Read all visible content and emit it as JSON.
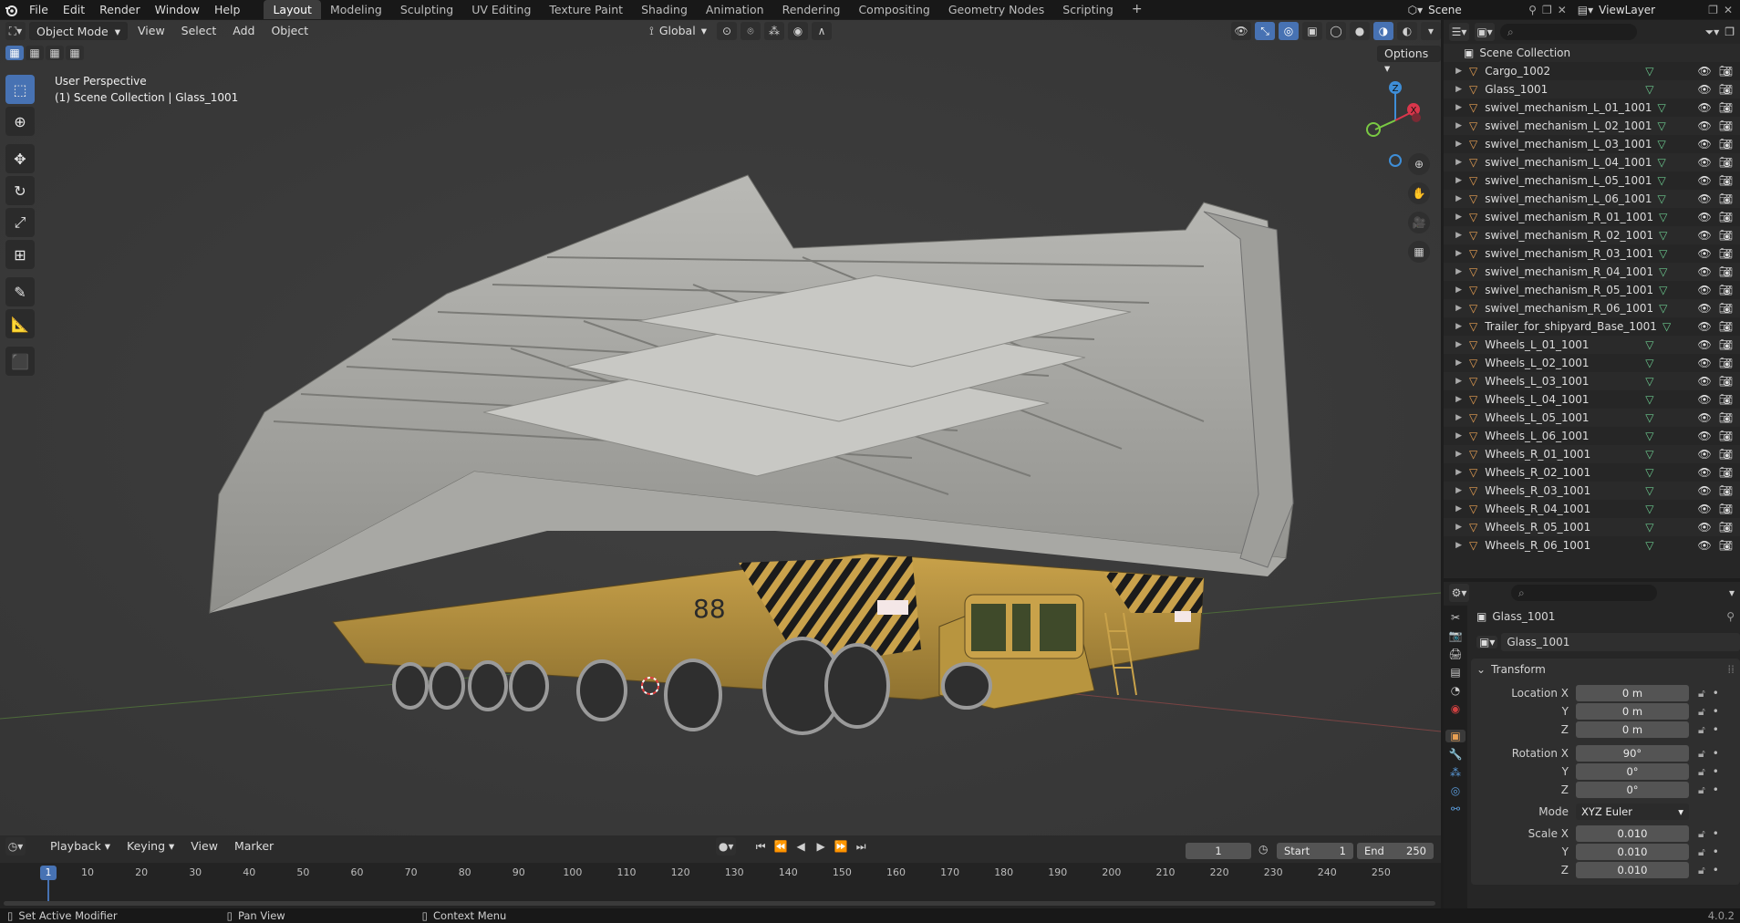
{
  "topbar": {
    "menus": [
      "File",
      "Edit",
      "Render",
      "Window",
      "Help"
    ],
    "workspaces": [
      "Layout",
      "Modeling",
      "Sculpting",
      "UV Editing",
      "Texture Paint",
      "Shading",
      "Animation",
      "Rendering",
      "Compositing",
      "Geometry Nodes",
      "Scripting"
    ],
    "active_workspace": "Layout",
    "scene_label": "Scene",
    "viewlayer_label": "ViewLayer"
  },
  "viewport": {
    "mode": "Object Mode",
    "menus": [
      "View",
      "Select",
      "Add",
      "Object"
    ],
    "orientation": "Global",
    "options_label": "Options",
    "overlay_title": "User Perspective",
    "overlay_subtitle": "(1) Scene Collection | Glass_1001",
    "gizmo": {
      "x": "X",
      "y": "Y",
      "z": "Z"
    },
    "model_marking": "88"
  },
  "timeline": {
    "menus": [
      "Playback",
      "Keying",
      "View",
      "Marker"
    ],
    "current_frame": "1",
    "start_label": "Start",
    "start_value": "1",
    "end_label": "End",
    "end_value": "250",
    "ruler": [
      "10",
      "20",
      "30",
      "40",
      "50",
      "60",
      "70",
      "80",
      "90",
      "100",
      "110",
      "120",
      "130",
      "140",
      "150",
      "160",
      "170",
      "180",
      "190",
      "200",
      "210",
      "220",
      "230",
      "240",
      "250"
    ],
    "ruler_current": "1"
  },
  "statusbar": {
    "left": "Set Active Modifier",
    "middle": "Pan View",
    "right": "Context Menu",
    "version": "4.0.2"
  },
  "outliner": {
    "root": "Scene Collection",
    "items": [
      {
        "name": "Cargo_1002",
        "icon": "mesh-object-icon"
      },
      {
        "name": "Glass_1001",
        "icon": "mesh-object-icon"
      },
      {
        "name": "swivel_mechanism_L_01_1001",
        "icon": "mesh-object-icon"
      },
      {
        "name": "swivel_mechanism_L_02_1001",
        "icon": "mesh-object-icon"
      },
      {
        "name": "swivel_mechanism_L_03_1001",
        "icon": "mesh-object-icon"
      },
      {
        "name": "swivel_mechanism_L_04_1001",
        "icon": "mesh-object-icon"
      },
      {
        "name": "swivel_mechanism_L_05_1001",
        "icon": "mesh-object-icon"
      },
      {
        "name": "swivel_mechanism_L_06_1001",
        "icon": "mesh-object-icon"
      },
      {
        "name": "swivel_mechanism_R_01_1001",
        "icon": "mesh-object-icon"
      },
      {
        "name": "swivel_mechanism_R_02_1001",
        "icon": "mesh-object-icon"
      },
      {
        "name": "swivel_mechanism_R_03_1001",
        "icon": "mesh-object-icon"
      },
      {
        "name": "swivel_mechanism_R_04_1001",
        "icon": "mesh-object-icon"
      },
      {
        "name": "swivel_mechanism_R_05_1001",
        "icon": "mesh-object-icon"
      },
      {
        "name": "swivel_mechanism_R_06_1001",
        "icon": "mesh-object-icon"
      },
      {
        "name": "Trailer_for_shipyard_Base_1001",
        "icon": "mesh-object-icon"
      },
      {
        "name": "Wheels_L_01_1001",
        "icon": "mesh-object-icon"
      },
      {
        "name": "Wheels_L_02_1001",
        "icon": "mesh-object-icon"
      },
      {
        "name": "Wheels_L_03_1001",
        "icon": "mesh-object-icon"
      },
      {
        "name": "Wheels_L_04_1001",
        "icon": "mesh-object-icon"
      },
      {
        "name": "Wheels_L_05_1001",
        "icon": "mesh-object-icon"
      },
      {
        "name": "Wheels_L_06_1001",
        "icon": "mesh-object-icon"
      },
      {
        "name": "Wheels_R_01_1001",
        "icon": "mesh-object-icon"
      },
      {
        "name": "Wheels_R_02_1001",
        "icon": "mesh-object-icon"
      },
      {
        "name": "Wheels_R_03_1001",
        "icon": "mesh-object-icon"
      },
      {
        "name": "Wheels_R_04_1001",
        "icon": "mesh-object-icon"
      },
      {
        "name": "Wheels_R_05_1001",
        "icon": "mesh-object-icon"
      },
      {
        "name": "Wheels_R_06_1001",
        "icon": "mesh-object-icon"
      }
    ]
  },
  "properties": {
    "object_name": "Glass_1001",
    "datablock_name": "Glass_1001",
    "panel_title": "Transform",
    "location": {
      "label": "Location X",
      "x": "0 m",
      "y": "0 m",
      "z": "0 m"
    },
    "rotation": {
      "label": "Rotation X",
      "x": "90°",
      "y": "0°",
      "z": "0°"
    },
    "mode": {
      "label": "Mode",
      "value": "XYZ Euler"
    },
    "scale": {
      "label": "Scale X",
      "x": "0.010",
      "y": "0.010",
      "z": "0.010"
    },
    "axis_y": "Y",
    "axis_z": "Z"
  },
  "colors": {
    "accent": "#4772b3",
    "object_orange": "#e8a053",
    "mesh_green": "#6bc98e",
    "axis_x": "#d9364b",
    "axis_y": "#7ac943",
    "axis_z": "#3e8ed8"
  }
}
